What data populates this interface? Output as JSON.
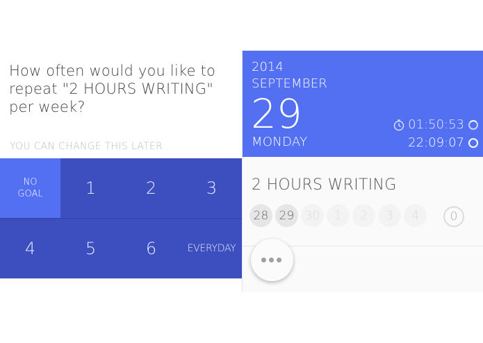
{
  "prompt": {
    "question": "How often would you like to repeat \"2 HOURS WRITING\" per week?",
    "hint": "YOU CAN CHANGE THIS LATER"
  },
  "frequency_options": [
    {
      "label": "NO GOAL",
      "selected": true
    },
    {
      "label": "1"
    },
    {
      "label": "2"
    },
    {
      "label": "3"
    },
    {
      "label": "4"
    },
    {
      "label": "5"
    },
    {
      "label": "6"
    },
    {
      "label": "EVERYDAY"
    }
  ],
  "date_header": {
    "year": "2014",
    "month": "SEPTEMBER",
    "day": "29",
    "weekday": "MONDAY",
    "elapsed": "01:50:53",
    "time": "22:09:07"
  },
  "habit": {
    "title": "2 HOURS WRITING",
    "days": [
      "28",
      "29",
      "30",
      "1",
      "2",
      "3",
      "4"
    ],
    "active_days": [
      "28",
      "29"
    ],
    "count": "0"
  },
  "more_button": {
    "label": "•••"
  },
  "colors": {
    "primary": "#5470f2",
    "primary_dark": "#3d4fbf",
    "text": "#444444",
    "hint": "#bdbdbd"
  },
  "icons": {
    "timer": "stopwatch-icon",
    "progress": "progress-ring-icon"
  }
}
